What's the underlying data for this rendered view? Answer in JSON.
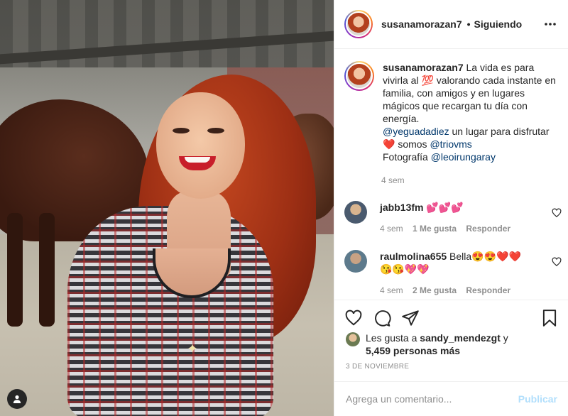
{
  "post": {
    "username": "susanamorazan7",
    "follow_sep": "•",
    "follow_status": "Siguiendo"
  },
  "caption": {
    "username": "susanamorazan7",
    "line1": " La vida es para vivirla al ",
    "emoji_100": "💯",
    "line2": "  valorando cada instante en familia, con amigos y en lugares mágicos que recargan tu día con energía.",
    "mention1": "@yeguadadiez",
    "line3": " un lugar para disfrutar",
    "heart": "❤️",
    "line4": " somos ",
    "mention2": "@triovms",
    "line5": "Fotografía ",
    "mention3": "@leoirungaray",
    "time": "4 sem"
  },
  "comments": [
    {
      "username": "jabb13fm",
      "text": " 💕💕💕",
      "time": "4 sem",
      "likes": "1 Me gusta",
      "reply": "Responder",
      "avatar_color": "#4a5a6e"
    },
    {
      "username": "raulmolina655",
      "text": " Bella😍😍❤️❤️😘😘💖💖",
      "time": "4 sem",
      "likes": "2 Me gusta",
      "reply": "Responder",
      "avatar_color": "#5d7a8c"
    }
  ],
  "likes": {
    "prefix": "Les gusta a ",
    "user": "sandy_mendezgt",
    "joiner": " y",
    "count": "5,459 personas más"
  },
  "date": "3 DE NOVIEMBRE",
  "add_comment": {
    "placeholder": "Agrega un comentario...",
    "publish": "Publicar"
  },
  "icons": {
    "more": "more-horizontal-icon",
    "like": "heart-icon",
    "comment": "comment-icon",
    "share": "share-icon",
    "save": "bookmark-icon",
    "photo_badge": "user-tag-icon"
  },
  "colors": {
    "text": "#262626",
    "muted": "#8e8e8e",
    "mention": "#00376b",
    "publish_disabled": "#b2dffc"
  }
}
